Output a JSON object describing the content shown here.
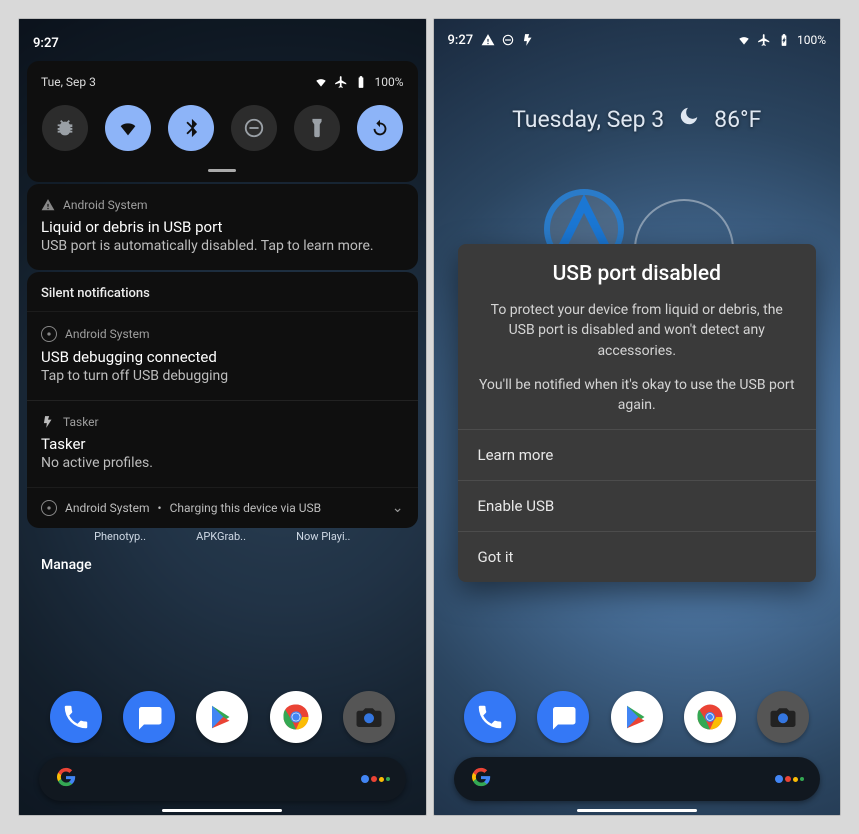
{
  "left": {
    "status_time": "9:27",
    "qs": {
      "date": "Tue, Sep 3",
      "battery": "100%",
      "tiles": [
        {
          "name": "bug-report",
          "active": false
        },
        {
          "name": "wifi",
          "active": true
        },
        {
          "name": "bluetooth",
          "active": true
        },
        {
          "name": "do-not-disturb",
          "active": false
        },
        {
          "name": "flashlight",
          "active": false
        },
        {
          "name": "auto-rotate",
          "active": true
        }
      ]
    },
    "notif1": {
      "app": "Android System",
      "title": "Liquid or debris in USB port",
      "body": "USB port is automatically disabled. Tap to learn more."
    },
    "silent_header": "Silent notifications",
    "notif2": {
      "app": "Android System",
      "title": "USB debugging connected",
      "body": "Tap to turn off USB debugging"
    },
    "notif3": {
      "app": "Tasker",
      "title": "Tasker",
      "body": "No active profiles."
    },
    "charging": {
      "app": "Android System",
      "text": "Charging this device via USB"
    },
    "manage": "Manage",
    "home_labels": [
      "Phenotyp..",
      "APKGrab..",
      "Now Playi.."
    ]
  },
  "right": {
    "status_time": "9:27",
    "battery": "100%",
    "date_line": "Tuesday, Sep 3",
    "temp": "86°F",
    "dialog": {
      "title": "USB port disabled",
      "p1": "To protect your device from liquid or debris, the USB port is disabled and won't detect any accessories.",
      "p2": "You'll be notified when it's okay to use the USB port again.",
      "btn1": "Learn more",
      "btn2": "Enable USB",
      "btn3": "Got it"
    }
  },
  "dock_apps": [
    "phone",
    "messages",
    "play-store",
    "chrome",
    "camera"
  ]
}
